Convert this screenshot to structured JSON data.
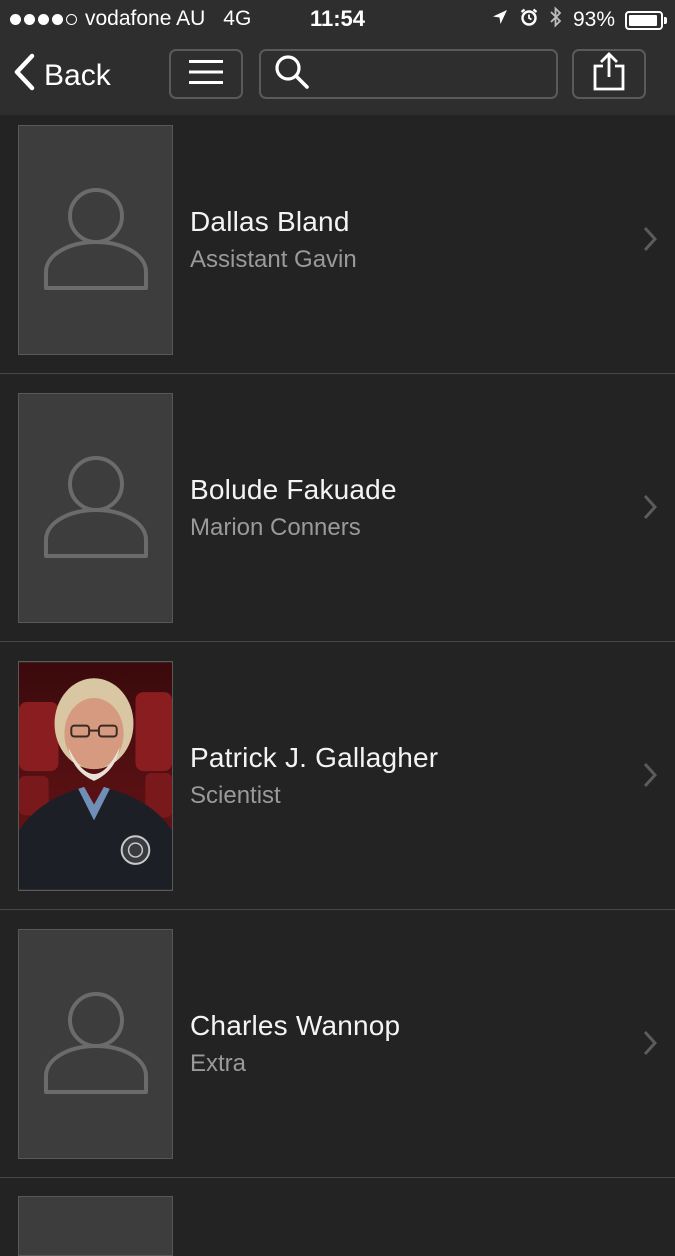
{
  "status_bar": {
    "carrier": "vodafone AU",
    "network": "4G",
    "time": "11:54",
    "battery_percent": "93%",
    "battery_level": 0.93,
    "signal_bars_filled": 4,
    "signal_bars_total": 5
  },
  "nav": {
    "back_label": "Back",
    "search_placeholder": ""
  },
  "colors": {
    "background": "#232323",
    "bar_background": "#2e2e2e",
    "name_text": "#f4f4f4",
    "role_text": "#9a9a9a",
    "placeholder_tile": "#3d3d3d"
  },
  "cast": [
    {
      "actor": "Dallas Bland",
      "role": "Assistant Gavin",
      "photo": "placeholder-person-icon"
    },
    {
      "actor": "Bolude Fakuade",
      "role": "Marion Conners",
      "photo": "placeholder-person-icon"
    },
    {
      "actor": "Patrick J. Gallagher",
      "role": "Scientist",
      "photo": "actor-photo"
    },
    {
      "actor": "Charles Wannop",
      "role": "Extra",
      "photo": "placeholder-person-icon"
    }
  ]
}
